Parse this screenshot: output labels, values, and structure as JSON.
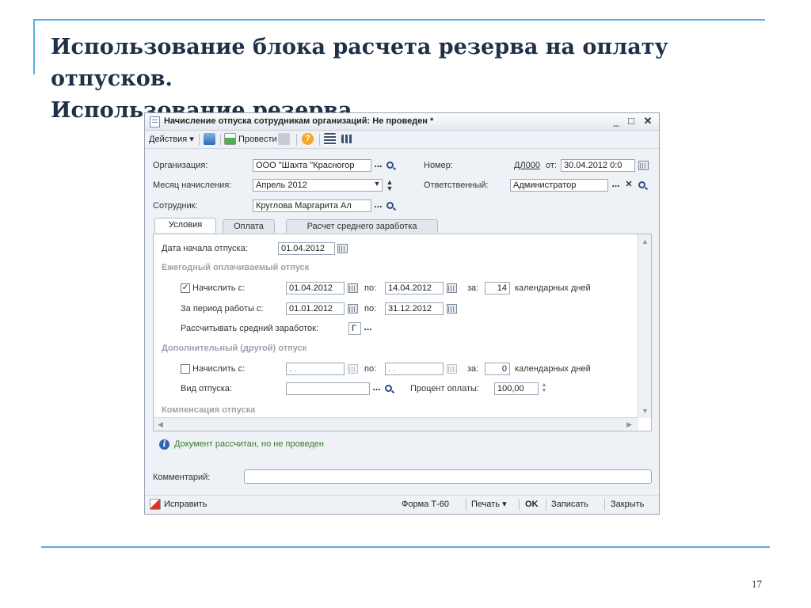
{
  "slide": {
    "title_line1": "Использование блока расчета резерва на оплату отпусков.",
    "title_line2": "Использование резерва",
    "page_number": "17"
  },
  "window": {
    "title": "Начисление отпуска сотрудникам организаций: Не проведен *",
    "minimize": "_",
    "maximize": "□",
    "close": "✕"
  },
  "toolbar": {
    "actions_label": "Действия ▾",
    "post_label": "Провести"
  },
  "header": {
    "org_label": "Организация:",
    "org_value": "ООО \"Шахта \"Красногор",
    "number_label": "Номер:",
    "number_value": "ДЛ000",
    "from_label": "от:",
    "date_value": "30.04.2012 0:0",
    "month_label": "Месяц начисления:",
    "month_value": "Апрель 2012",
    "responsible_label": "Ответственный:",
    "responsible_value": "Администратор",
    "employee_label": "Сотрудник:",
    "employee_value": "Круглова Маргарита Ал"
  },
  "tabs": [
    {
      "label": "Условия"
    },
    {
      "label": "Оплата"
    },
    {
      "label": "Расчет среднего заработка"
    }
  ],
  "conditions": {
    "start_label": "Дата начала отпуска:",
    "start_value": "01.04.2012",
    "annual_section": "Ежегодный оплачиваемый отпуск",
    "accrue_label": "Начислить с:",
    "accrue_checked": "✓",
    "accrue_from": "01.04.2012",
    "to_label": "по:",
    "accrue_to": "14.04.2012",
    "for_label": "за:",
    "days_value": "14",
    "days_label": "календарных дней",
    "period_label": "За период работы с:",
    "period_from": "01.01.2012",
    "period_to": "31.12.2012",
    "avg_label": "Рассчитывать средний заработок:",
    "avg_value": "Г",
    "extra_section": "Дополнительный (другой) отпуск",
    "extra_accrue_label": "Начислить с:",
    "extra_from": " .  .",
    "extra_to": " .  .",
    "extra_days": "0",
    "extra_days_label": "календарных дней",
    "vacation_type_label": "Вид отпуска:",
    "vacation_type_value": "",
    "percent_label": "Процент оплаты:",
    "percent_value": "100,00",
    "comp_section": "Компенсация отпуска"
  },
  "status": {
    "message": "Документ рассчитан, но не проведен"
  },
  "comment": {
    "label": "Комментарий:",
    "value": ""
  },
  "bottom": {
    "edit_label": "Исправить",
    "form_label": "Форма Т-60",
    "print_label": "Печать ▾",
    "ok_label": "OK",
    "save_label": "Записать",
    "close_label": "Закрыть"
  }
}
